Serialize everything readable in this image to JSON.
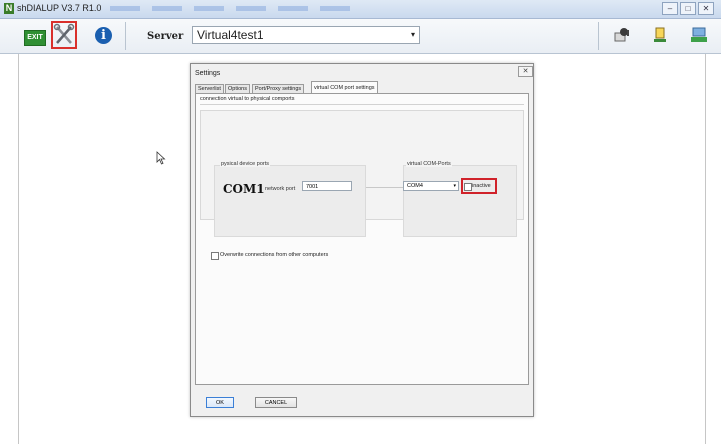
{
  "window": {
    "title": "shDIALUP V3.7 R1.0",
    "minimize_glyph": "–",
    "maximize_glyph": "□",
    "close_glyph": "✕"
  },
  "toolbar": {
    "exit_label": "EXIT",
    "info_glyph": "i",
    "server_label": "Server",
    "server_value": "Virtual4test1",
    "dropdown_glyph": "▾"
  },
  "dialog": {
    "title": "Settings",
    "close_glyph": "✕",
    "tabs": [
      "Serverlist",
      "Options",
      "Port/Proxy settings",
      "virtual COM port settings"
    ],
    "panel_heading": "connection virtual to physical comports",
    "physical": {
      "group_label": "pysical device ports",
      "com_name": "COM1",
      "port_label": "network port",
      "port_value": "7001"
    },
    "virtual": {
      "group_label": "virtual COM-Ports",
      "selected_port": "COM4",
      "inactive_label": "inactive",
      "inactive_checked": false
    },
    "overwrite_label": "Overwrite connections from other computers",
    "overwrite_checked": false,
    "ok_label": "OK",
    "cancel_label": "CANCEL"
  },
  "colors": {
    "highlight": "#d9302c",
    "exit_green": "#2f8f33",
    "info_blue": "#1a5fb0"
  },
  "icons": [
    "app-logo-icon",
    "tools-icon",
    "info-icon",
    "dropdown-icon",
    "user-card-icon",
    "logout-icon",
    "network-icon",
    "mouse-cursor-icon"
  ]
}
